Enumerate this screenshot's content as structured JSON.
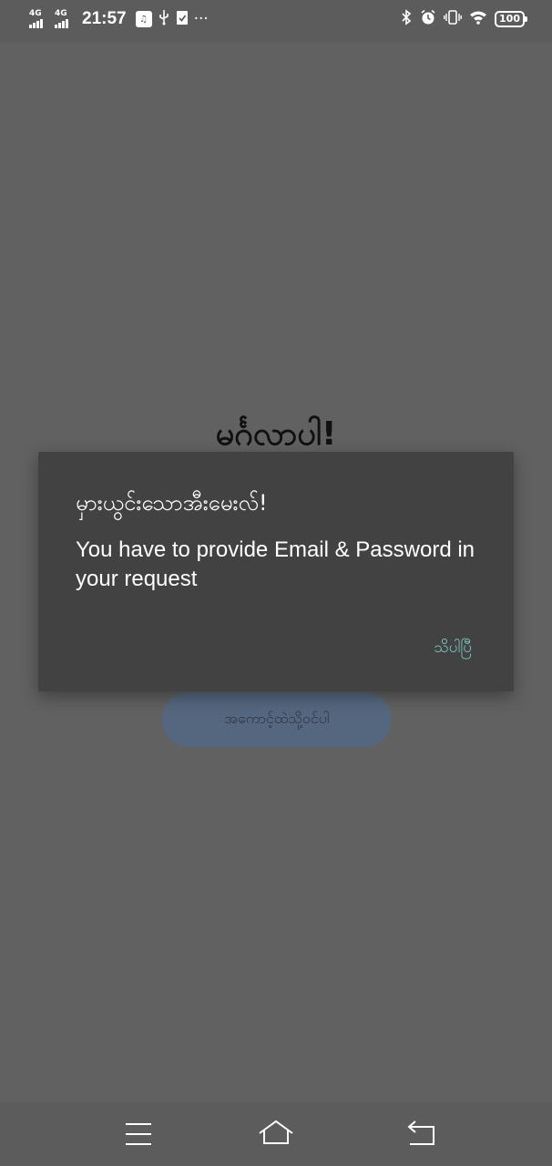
{
  "status_bar": {
    "network1": "4G",
    "network2": "4G",
    "time": "21:57",
    "more": "···",
    "battery": "100",
    "icons": [
      "signal-icon",
      "signal-icon",
      "app-badge-icon",
      "usb-icon",
      "check-shield-icon",
      "bluetooth-icon",
      "alarm-icon",
      "vibrate-icon",
      "wifi-icon",
      "battery-icon"
    ]
  },
  "page": {
    "welcome_title": "မင်္ဂလာပါ!",
    "login_button": "အကောင့်ထဲသို့ဝင်ပါ"
  },
  "dialog": {
    "title": "မှားယွင်းသောအီးမေးလ်!",
    "message": "You have to provide Email & Password in your request",
    "ok_button": "သိပါပြီ"
  },
  "nav": {
    "icons": [
      "menu-icon",
      "home-icon",
      "back-icon"
    ]
  },
  "colors": {
    "scrim": "#616161",
    "dialog_bg": "#424242",
    "accent": "#7fcbc4",
    "button_bg": "#55677f"
  }
}
